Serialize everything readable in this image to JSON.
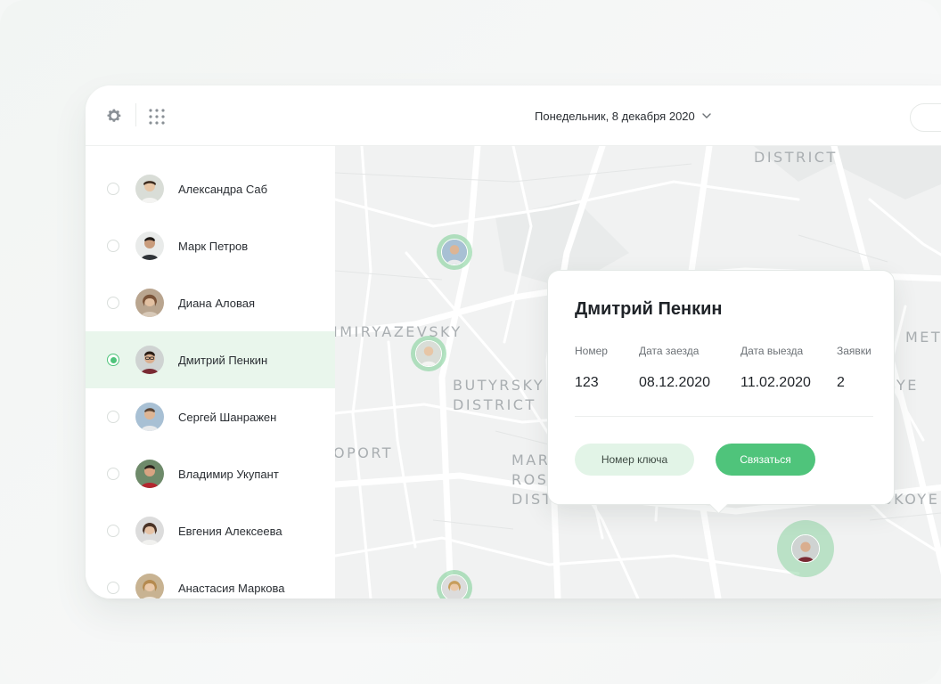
{
  "header": {
    "date_label": "Понедельник, 8 декабря 2020",
    "icons": [
      "gear-icon",
      "grid-icon",
      "chevron-down-icon"
    ]
  },
  "sidebar": {
    "people": [
      {
        "name": "Александра Саб",
        "selected": false
      },
      {
        "name": "Марк Петров",
        "selected": false
      },
      {
        "name": "Диана Аловая",
        "selected": false
      },
      {
        "name": "Дмитрий Пенкин",
        "selected": true
      },
      {
        "name": "Сергей Шанражен",
        "selected": false
      },
      {
        "name": "Владимир Укупант",
        "selected": false
      },
      {
        "name": "Евгения Алексеева",
        "selected": false
      },
      {
        "name": "Анастасия Маркова",
        "selected": false
      }
    ]
  },
  "map": {
    "labels": {
      "district_top": "DISTRICT",
      "timiryazevsky": "IMIRYAZEVSKY",
      "butyrsky": "BUTYRSKY\nDISTRICT",
      "oport": "OPORT",
      "marfino": "MAR\nROS\nDISTRICT",
      "met": "MET",
      "ye": "YE",
      "preobrazhenskoye": "PREOBRAZHENSKOYE"
    }
  },
  "popup": {
    "name": "Дмитрий Пенкин",
    "columns": [
      {
        "header": "Номер",
        "value": "123"
      },
      {
        "header": "Дата заезда",
        "value": "08.12.2020"
      },
      {
        "header": "Дата выезда",
        "value": "11.02.2020"
      },
      {
        "header": "Заявки",
        "value": "2"
      }
    ],
    "key_button": "Номер ключа",
    "contact_button": "Связаться"
  },
  "colors": {
    "accent": "#4fc47b",
    "accent_light": "#e2f4e7",
    "selected_row": "#e9f6ec",
    "map_bg": "#f1f2f2"
  }
}
